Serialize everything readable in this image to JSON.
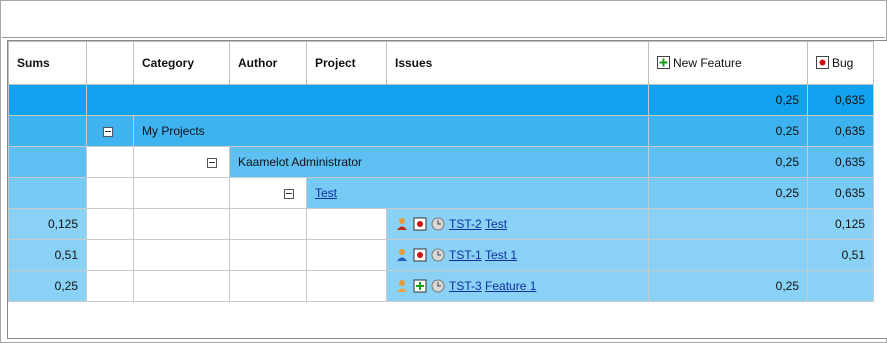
{
  "columns": {
    "sums": "Sums",
    "blank": "",
    "category": "Category",
    "author": "Author",
    "project": "Project",
    "issues": "Issues",
    "new_feature": "New Feature",
    "bug": "Bug"
  },
  "rows": [
    {
      "level": "total",
      "new_feature": "0,25",
      "bug": "0,635"
    },
    {
      "level": "category",
      "label": "My Projects",
      "new_feature": "0,25",
      "bug": "0,635"
    },
    {
      "level": "author",
      "label": "Kaamelot Administrator",
      "new_feature": "0,25",
      "bug": "0,635"
    },
    {
      "level": "project",
      "label": "Test",
      "new_feature": "0,25",
      "bug": "0,635"
    },
    {
      "level": "issue",
      "sums": "0,125",
      "key": "TST-2",
      "summary": "Test",
      "type": "bug",
      "priority": "red-person",
      "new_feature": "",
      "bug": "0,125"
    },
    {
      "level": "issue",
      "sums": "0,51",
      "key": "TST-1",
      "summary": "Test 1",
      "type": "bug",
      "priority": "blue-person",
      "new_feature": "",
      "bug": "0,51"
    },
    {
      "level": "issue",
      "sums": "0,25",
      "key": "TST-3",
      "summary": "Feature 1",
      "type": "new-feature",
      "priority": "orange-person",
      "new_feature": "0,25",
      "bug": ""
    }
  ],
  "colors": {
    "total_row": "#11a3ef",
    "category_row": "#3fb2f0",
    "author_row": "#5ec0f2",
    "project_row": "#76caf3",
    "issue_row": "#8ad2f5",
    "link": "#0f2f9e"
  }
}
